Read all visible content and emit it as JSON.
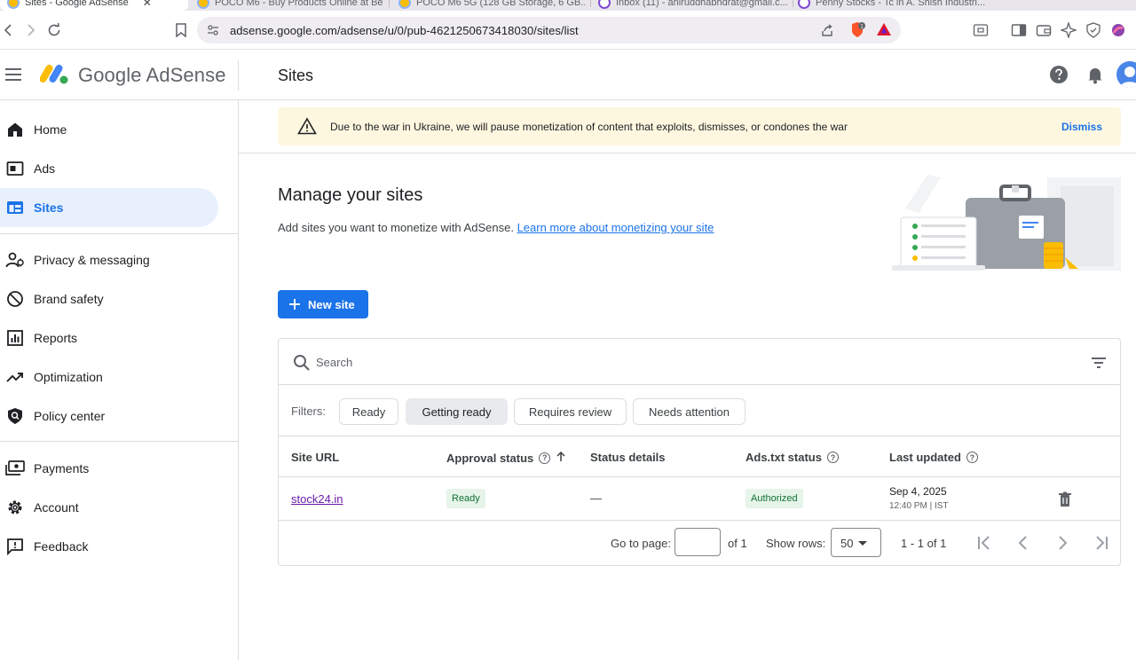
{
  "browser": {
    "tabs": [
      {
        "title": "Sites - Google AdSense",
        "active": true
      },
      {
        "title": "POCO M6 - Buy Products Online at Be...",
        "active": false
      },
      {
        "title": "POCO M6 5G (128 GB Storage, 6 GB...",
        "active": false
      },
      {
        "title": "Inbox (11) - aniruddhabhdrat@gmail.c...",
        "active": false
      },
      {
        "title": "Penny Stocks - Tc in A. Shish Industri...",
        "active": false
      }
    ],
    "url_domain": "adsense.google.com",
    "url_path": "/adsense/u/0/pub-4621250673418030/sites/list",
    "brave_badge": "1"
  },
  "header": {
    "brand": "Google AdSense",
    "page_title": "Sites"
  },
  "sidebar": {
    "items": [
      {
        "label": "Home",
        "icon": "home-icon"
      },
      {
        "label": "Ads",
        "icon": "ads-icon"
      },
      {
        "label": "Sites",
        "icon": "sites-icon",
        "active": true
      },
      {
        "label": "Privacy & messaging",
        "icon": "privacy-icon"
      },
      {
        "label": "Brand safety",
        "icon": "block-icon"
      },
      {
        "label": "Reports",
        "icon": "reports-icon"
      },
      {
        "label": "Optimization",
        "icon": "trending-icon"
      },
      {
        "label": "Policy center",
        "icon": "policy-icon"
      },
      {
        "label": "Payments",
        "icon": "payments-icon"
      },
      {
        "label": "Account",
        "icon": "gear-icon"
      },
      {
        "label": "Feedback",
        "icon": "feedback-icon"
      }
    ]
  },
  "banner": {
    "message": "Due to the war in Ukraine, we will pause monetization of content that exploits, dismisses, or condones the war",
    "dismiss": "Dismiss"
  },
  "manage": {
    "title": "Manage your sites",
    "subtitle": "Add sites you want to monetize with AdSense.",
    "learn_more": "Learn more about monetizing your site",
    "new_site": "New site"
  },
  "table": {
    "search_placeholder": "Search",
    "filters_label": "Filters:",
    "filters": [
      "Ready",
      "Getting ready",
      "Requires review",
      "Needs attention"
    ],
    "selected_filter": "Getting ready",
    "columns": [
      "Site URL",
      "Approval status",
      "Status details",
      "Ads.txt status",
      "Last updated"
    ],
    "rows": [
      {
        "site_url": "stock24.in",
        "approval_status": "Ready",
        "status_details": "—",
        "ads_txt_status": "Authorized",
        "last_updated_date": "Sep 4, 2025",
        "last_updated_time": "12:40 PM | IST"
      }
    ],
    "pager": {
      "go_to_page": "Go to page:",
      "of_pages": "of 1",
      "show_rows": "Show rows:",
      "rows_value": "50",
      "range": "1 - 1 of 1"
    }
  },
  "colors": {
    "primary": "#1a73e8",
    "active_nav_bg": "#e8f0fe",
    "banner_bg": "#fef7e0",
    "success_bg": "#e6f4ea",
    "success_text": "#137333"
  }
}
